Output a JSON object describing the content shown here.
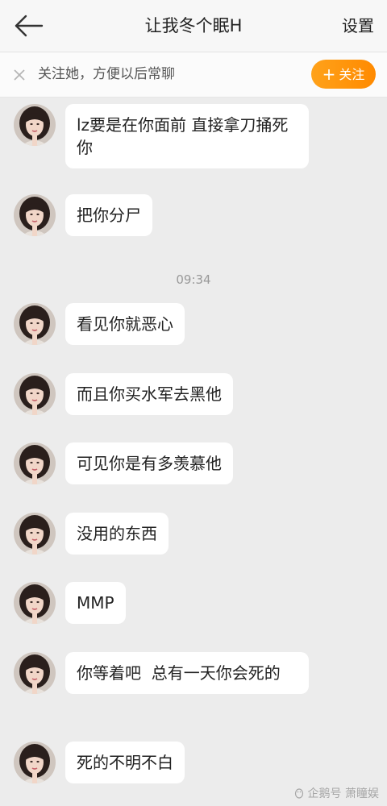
{
  "header": {
    "title": "让我冬个眠H",
    "settings_label": "设置"
  },
  "follow_bar": {
    "text": "关注她，方便以后常聊",
    "button_label": "关注"
  },
  "messages": [
    {
      "text": "lz要是在你面前 直接拿刀捅死你"
    },
    {
      "text": "把你分尸"
    },
    {
      "text": "看见你就恶心"
    },
    {
      "text": "而且你买水军去黑他"
    },
    {
      "text": "可见你是有多羡慕他"
    },
    {
      "text": "没用的东西"
    },
    {
      "text": "MMP"
    },
    {
      "text": "你等着吧  总有一天你会死的"
    },
    {
      "text": "死的不明不白"
    }
  ],
  "timestamp": "09:34",
  "watermark": "企鹅号 萧瞳娱",
  "colors": {
    "accent": "#ff9500",
    "background": "#ececec",
    "bubble": "#ffffff"
  }
}
